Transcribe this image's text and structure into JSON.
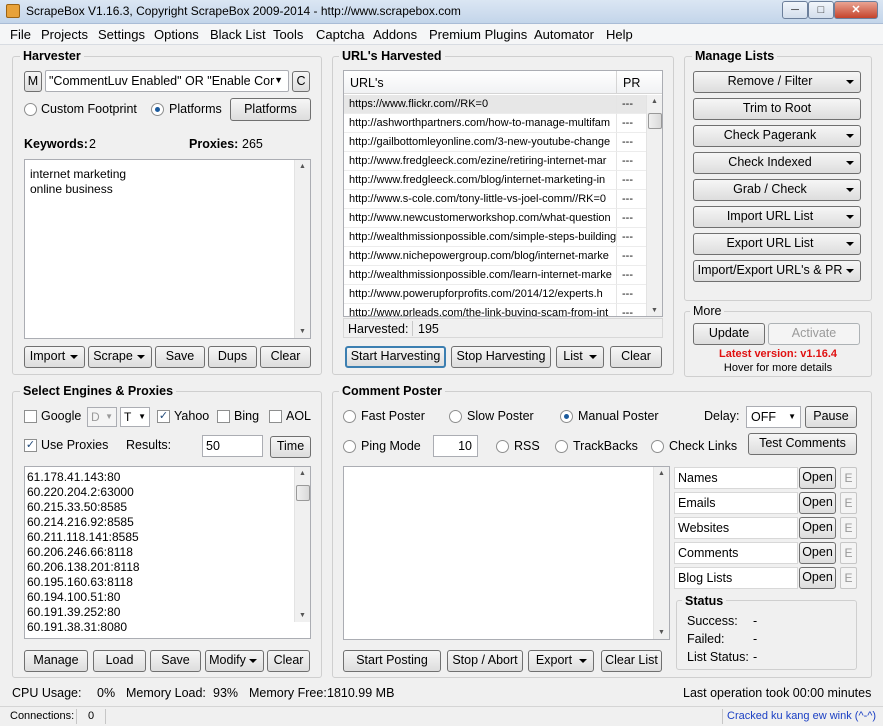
{
  "window": {
    "title": "ScrapeBox V1.16.3, Copyright ScrapeBox 2009-2014 - http://www.scrapebox.com",
    "min": "─",
    "max": "□",
    "close": "✕"
  },
  "menu": [
    "File",
    "Projects",
    "Settings",
    "Options",
    "Black List",
    "Tools",
    "Captcha",
    "Addons",
    "Premium Plugins",
    "Automator",
    "Help"
  ],
  "harvester": {
    "title": "Harvester",
    "m_label": "M",
    "query": "\"CommentLuv Enabled\" OR \"Enable Cor",
    "c_label": "C",
    "custom_footprint": "Custom Footprint",
    "platforms_radio": "Platforms",
    "platforms_button": "Platforms",
    "keywords_label": "Keywords:",
    "keywords_count": "2",
    "proxies_label": "Proxies:",
    "proxies_count": "265",
    "keywords": [
      "internet marketing",
      "online business"
    ],
    "buttons": {
      "import": "Import",
      "scrape": "Scrape",
      "save": "Save",
      "dups": "Dups",
      "clear": "Clear"
    }
  },
  "urls": {
    "title": "URL's Harvested",
    "col_url": "URL's",
    "col_pr": "PR",
    "rows": [
      {
        "url": "https://www.flickr.com//RK=0",
        "pr": "---"
      },
      {
        "url": "http://ashworthpartners.com/how-to-manage-multifam",
        "pr": "---"
      },
      {
        "url": "http://gailbottomleyonline.com/3-new-youtube-change",
        "pr": "---"
      },
      {
        "url": "http://www.fredgleeck.com/ezine/retiring-internet-mar",
        "pr": "---"
      },
      {
        "url": "http://www.fredgleeck.com/blog/internet-marketing-in",
        "pr": "---"
      },
      {
        "url": "http://www.s-cole.com/tony-little-vs-joel-comm//RK=0",
        "pr": "---"
      },
      {
        "url": "http://www.newcustomerworkshop.com/what-question",
        "pr": "---"
      },
      {
        "url": "http://wealthmissionpossible.com/simple-steps-building",
        "pr": "---"
      },
      {
        "url": "http://www.nichepowergroup.com/blog/internet-marke",
        "pr": "---"
      },
      {
        "url": "http://wealthmissionpossible.com/learn-internet-marke",
        "pr": "---"
      },
      {
        "url": "http://www.powerupforprofits.com/2014/12/experts.h",
        "pr": "---"
      },
      {
        "url": "http://www.prleads.com/the-link-buying-scam-from-int",
        "pr": "---"
      }
    ],
    "harvested_label": "Harvested:",
    "harvested_count": "195",
    "buttons": {
      "start": "Start Harvesting",
      "stop": "Stop Harvesting",
      "list": "List",
      "clear": "Clear"
    }
  },
  "manage": {
    "title": "Manage Lists",
    "buttons": [
      "Remove / Filter",
      "Trim to Root",
      "Check Pagerank",
      "Check Indexed",
      "Grab / Check",
      "Import URL List",
      "Export URL List",
      "Import/Export URL's & PR"
    ]
  },
  "more": {
    "title": "More",
    "update": "Update",
    "activate": "Activate",
    "latest": "Latest version: v1.16.4",
    "hover": "Hover for more details",
    "latest_color": "#e01010"
  },
  "engines": {
    "title": "Select Engines & Proxies",
    "google": "Google",
    "google_sel": "D",
    "yahoo_sel": "T",
    "yahoo": "Yahoo",
    "bing": "Bing",
    "aol": "AOL",
    "use_proxies": "Use Proxies",
    "results_label": "Results:",
    "results_value": "50",
    "time": "Time",
    "proxies": [
      "61.178.41.143:80",
      "60.220.204.2:63000",
      "60.215.33.50:8585",
      "60.214.216.92:8585",
      "60.211.118.141:8585",
      "60.206.246.66:8118",
      "60.206.138.201:8118",
      "60.195.160.63:8118",
      "60.194.100.51:80",
      "60.191.39.252:80",
      "60.191.38.31:8080"
    ],
    "buttons": {
      "manage": "Manage",
      "load": "Load",
      "save": "Save",
      "modify": "Modify",
      "clear": "Clear"
    }
  },
  "poster": {
    "title": "Comment Poster",
    "fast": "Fast Poster",
    "slow": "Slow Poster",
    "manual": "Manual Poster",
    "delay_label": "Delay:",
    "delay_value": "OFF",
    "pause": "Pause",
    "ping": "Ping Mode",
    "ping_value": "10",
    "rss": "RSS",
    "trackbacks": "TrackBacks",
    "check_links": "Check Links",
    "test_comments": "Test Comments",
    "lists": [
      {
        "name": "Names",
        "open": "Open",
        "e": "E"
      },
      {
        "name": "Emails",
        "open": "Open",
        "e": "E"
      },
      {
        "name": "Websites",
        "open": "Open",
        "e": "E"
      },
      {
        "name": "Comments",
        "open": "Open",
        "e": "E"
      },
      {
        "name": "Blog Lists",
        "open": "Open",
        "e": "E"
      }
    ],
    "status_title": "Status",
    "success_label": "Success:",
    "success_value": "-",
    "failed_label": "Failed:",
    "failed_value": "-",
    "list_status_label": "List Status:",
    "list_status_value": "-",
    "buttons": {
      "start": "Start Posting",
      "stop": "Stop / Abort",
      "export": "Export",
      "clear": "Clear List"
    }
  },
  "footer": {
    "cpu_label": "CPU Usage:",
    "cpu_value": "0%",
    "mem_label": "Memory Load:",
    "mem_value": "93%",
    "free_label": "Memory Free:",
    "free_value": "1810.99 MB",
    "last_op": "Last operation took 00:00 minutes"
  },
  "statusbar": {
    "connections_label": "Connections:",
    "connections_value": "0",
    "credit": "Cracked ku kang ew wink (^-^)",
    "credit_color": "#1a3fc4"
  }
}
